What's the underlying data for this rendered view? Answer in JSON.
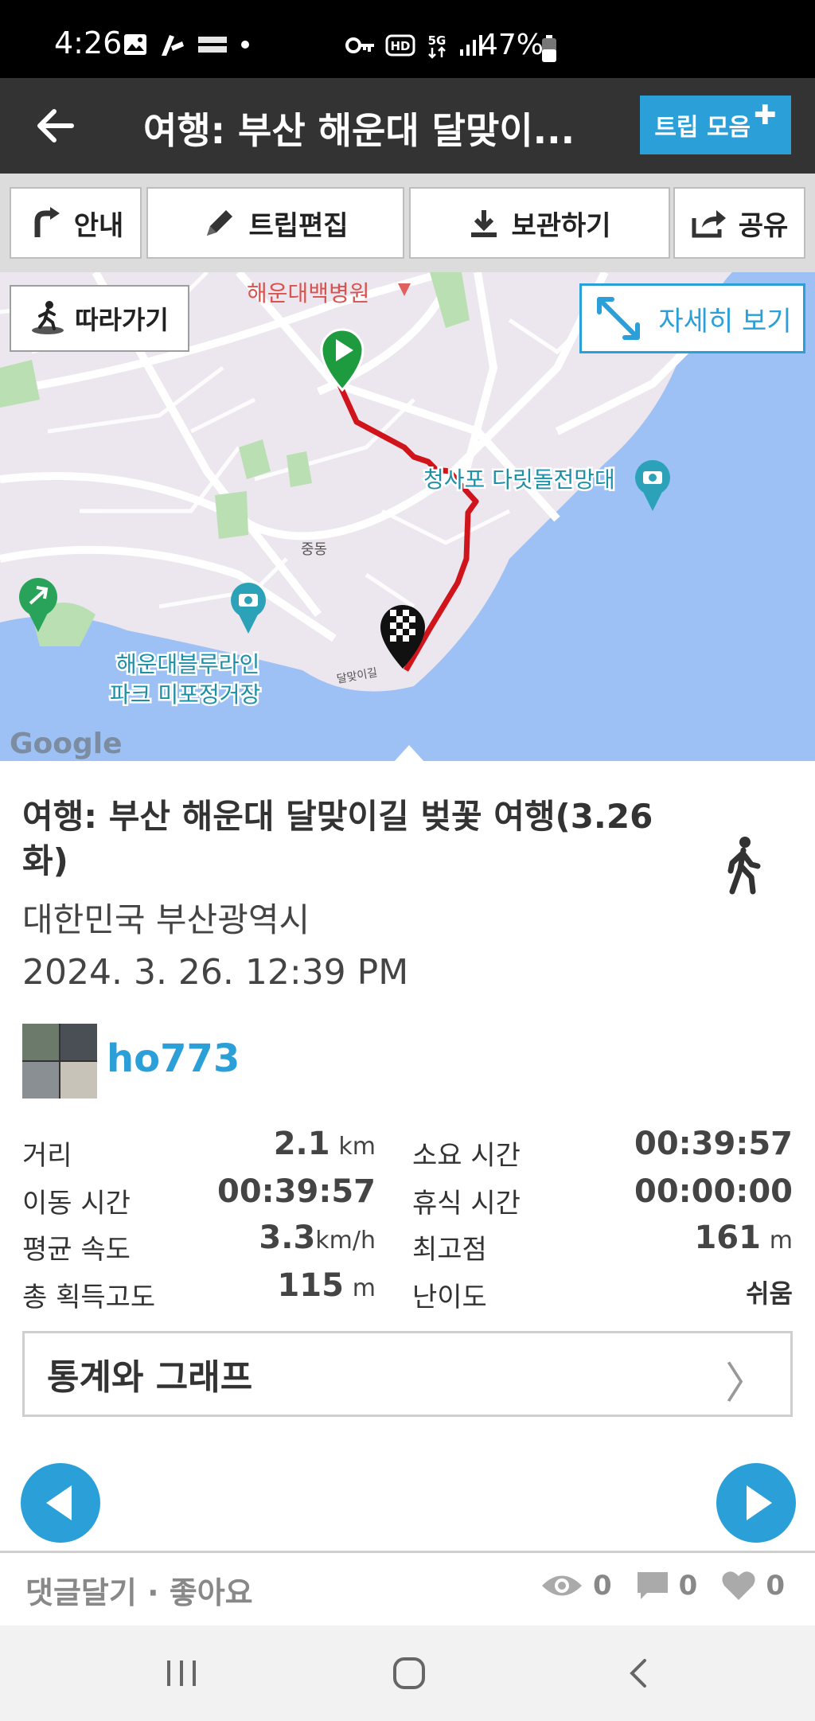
{
  "status_bar": {
    "time": "4:26",
    "battery": "47%",
    "network": "5G"
  },
  "app_bar": {
    "title": "여행: 부산 해운대 달맞이...",
    "trip_collect_label": "트립 모음"
  },
  "toolbar": {
    "guide_label": "안내",
    "edit_label": "트립편집",
    "save_label": "보관하기",
    "share_label": "공유"
  },
  "map": {
    "follow_label": "따라가기",
    "detail_label": "자세히 보기",
    "labels": {
      "hospital": "해운대백병원",
      "observatory": "청사포 다릿돌전망대",
      "station_line1": "해운대블루라인",
      "station_line2": "파크 미포정거장",
      "jung_dong": "중동",
      "dalmaji": "달맞이길",
      "google": "Google"
    }
  },
  "trip": {
    "title": "여행: 부산 해운대 달맞이길 벚꽃 여행(3.26 화)",
    "location": "대한민국 부산광역시",
    "date": "2024. 3. 26. 12:39 PM",
    "username": "ho773"
  },
  "stats": {
    "distance_label": "거리",
    "distance_value": "2.1",
    "distance_unit": "km",
    "duration_label": "소요 시간",
    "duration_value": "00:39:57",
    "moving_label": "이동 시간",
    "moving_value": "00:39:57",
    "rest_label": "휴식 시간",
    "rest_value": "00:00:00",
    "avg_speed_label": "평균 속도",
    "avg_speed_value": "3.3",
    "avg_speed_unit": "km/h",
    "max_alt_label": "최고점",
    "max_alt_value": "161",
    "max_alt_unit": "m",
    "gain_label": "총 획득고도",
    "gain_value": "115",
    "gain_unit": "m",
    "difficulty_label": "난이도",
    "difficulty_value": "쉬움"
  },
  "stats_graph_label": "통계와 그래프",
  "footer": {
    "comment_like": "댓글달기 · 좋아요",
    "views": "0",
    "comments": "0",
    "likes": "0"
  },
  "colors": {
    "accent": "#2b9fd8",
    "app_bar": "#333333",
    "route": "#d0141c"
  }
}
